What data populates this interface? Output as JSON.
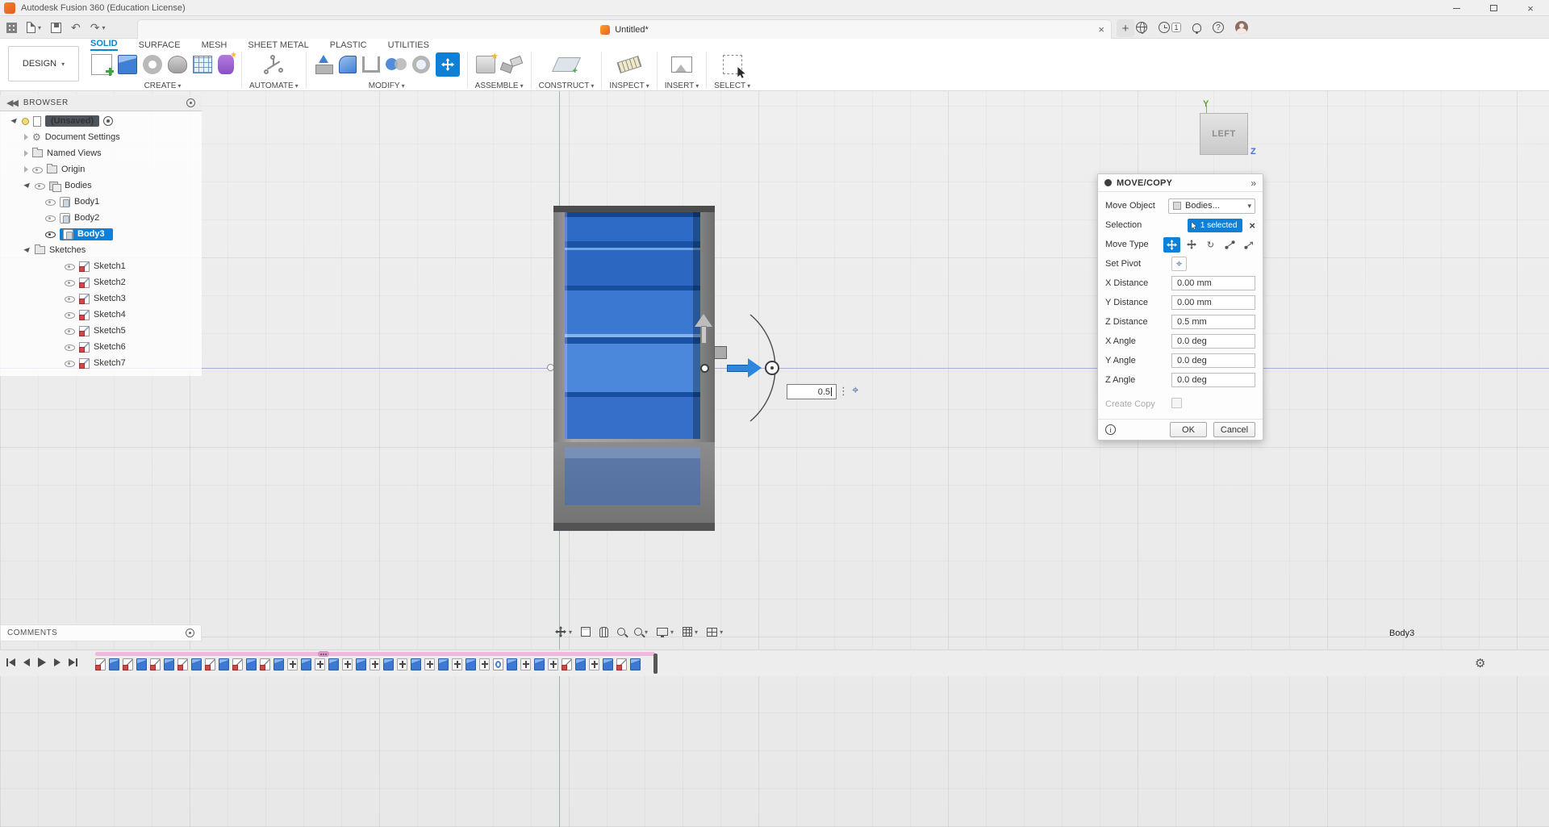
{
  "titlebar": {
    "title": "Autodesk Fusion 360 (Education License)"
  },
  "tabbar": {
    "document_tab": "Untitled*",
    "notification_count": "1"
  },
  "ribbon": {
    "design_label": "DESIGN",
    "tabs": [
      "SOLID",
      "SURFACE",
      "MESH",
      "SHEET METAL",
      "PLASTIC",
      "UTILITIES"
    ],
    "groups": [
      "CREATE",
      "AUTOMATE",
      "MODIFY",
      "ASSEMBLE",
      "CONSTRUCT",
      "INSPECT",
      "INSERT",
      "SELECT"
    ]
  },
  "browser": {
    "header": "BROWSER",
    "root_label": "(Unsaved)",
    "document_settings": "Document Settings",
    "named_views": "Named Views",
    "origin": "Origin",
    "bodies_label": "Bodies",
    "bodies": [
      "Body1",
      "Body2",
      "Body3"
    ],
    "selected_body": "Body3",
    "sketches_label": "Sketches",
    "sketches": [
      "Sketch1",
      "Sketch2",
      "Sketch3",
      "Sketch4",
      "Sketch5",
      "Sketch6",
      "Sketch7"
    ]
  },
  "viewcube": {
    "face": "LEFT",
    "axis_y": "Y",
    "axis_z": "Z"
  },
  "canvas": {
    "manipulator_value": "0.5",
    "selected_body_status": "Body3"
  },
  "move_copy": {
    "title": "MOVE/COPY",
    "rows": {
      "move_object": {
        "label": "Move Object",
        "value": "Bodies..."
      },
      "selection": {
        "label": "Selection",
        "value": "1 selected"
      },
      "move_type": {
        "label": "Move Type"
      },
      "set_pivot": {
        "label": "Set Pivot"
      },
      "create_copy": {
        "label": "Create Copy"
      }
    },
    "inputs": [
      {
        "label": "X Distance",
        "value": "0.00 mm"
      },
      {
        "label": "Y Distance",
        "value": "0.00 mm"
      },
      {
        "label": "Z Distance",
        "value": "0.5 mm"
      },
      {
        "label": "X Angle",
        "value": "0.0 deg"
      },
      {
        "label": "Y Angle",
        "value": "0.0 deg"
      },
      {
        "label": "Z Angle",
        "value": "0.0 deg"
      }
    ],
    "ok_label": "OK",
    "cancel_label": "Cancel"
  },
  "comments": {
    "label": "COMMENTS"
  },
  "nav": {
    "buttons": [
      "orbit",
      "look-at",
      "pan",
      "zoom",
      "zoom-window",
      "display-settings",
      "grid-and-snaps",
      "viewports"
    ]
  },
  "timeline": {
    "playback": [
      "go-to-start",
      "step-back",
      "play",
      "step-forward",
      "go-to-end"
    ],
    "features": [
      "sketch",
      "solid",
      "sketch",
      "solid",
      "sketch",
      "solid",
      "sketch",
      "solid",
      "sketch",
      "solid",
      "sketch",
      "solid",
      "sketch",
      "solid",
      "move",
      "solid",
      "move",
      "solid",
      "move",
      "solid",
      "move",
      "solid",
      "move",
      "solid",
      "move",
      "solid",
      "move",
      "solid",
      "move",
      "pattern",
      "solid",
      "move",
      "solid",
      "move",
      "sketch",
      "solid",
      "move",
      "solid",
      "sketch",
      "solid"
    ]
  }
}
